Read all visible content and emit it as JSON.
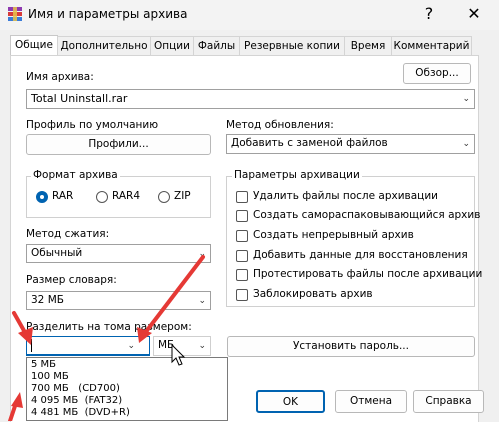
{
  "window": {
    "title": "Имя и параметры архива",
    "help": "?",
    "close": "✕"
  },
  "tabs": [
    {
      "label": "Общие"
    },
    {
      "label": "Дополнительно"
    },
    {
      "label": "Опции"
    },
    {
      "label": "Файлы"
    },
    {
      "label": "Резервные копии"
    },
    {
      "label": "Время"
    },
    {
      "label": "Комментарий"
    }
  ],
  "archive_name": {
    "label": "Имя архива:",
    "value": "Total Uninstall.rar",
    "browse": "Обзор..."
  },
  "profile": {
    "label": "Профиль по умолчанию",
    "button": "Профили..."
  },
  "update_method": {
    "label": "Метод обновления:",
    "value": "Добавить с заменой файлов"
  },
  "format": {
    "title": "Формат архива",
    "options": [
      "RAR",
      "RAR4",
      "ZIP"
    ],
    "selected": "RAR"
  },
  "compression": {
    "label": "Метод сжатия:",
    "value": "Обычный"
  },
  "dictionary": {
    "label": "Размер словаря:",
    "value": "32 МБ"
  },
  "split": {
    "label": "Разделить на тома размером:",
    "value": "",
    "unit": "МБ"
  },
  "options_group": {
    "title": "Параметры архивации",
    "items": [
      "Удалить файлы после архивации",
      "Создать самораспаковывающийся архив",
      "Создать непрерывный архив",
      "Добавить данные для восстановления",
      "Протестировать файлы после архивации",
      "Заблокировать архив"
    ]
  },
  "password_button": "Установить пароль...",
  "split_dropdown": [
    "5 МБ",
    "100 МБ",
    "700 МБ   (CD700)",
    "4 095 МБ  (FAT32)",
    "4 481 МБ  (DVD+R)"
  ],
  "buttons": {
    "ok": "OK",
    "cancel": "Отмена",
    "help": "Справка"
  },
  "colors": {
    "accent": "#0063b1",
    "arrow": "#e53935"
  }
}
